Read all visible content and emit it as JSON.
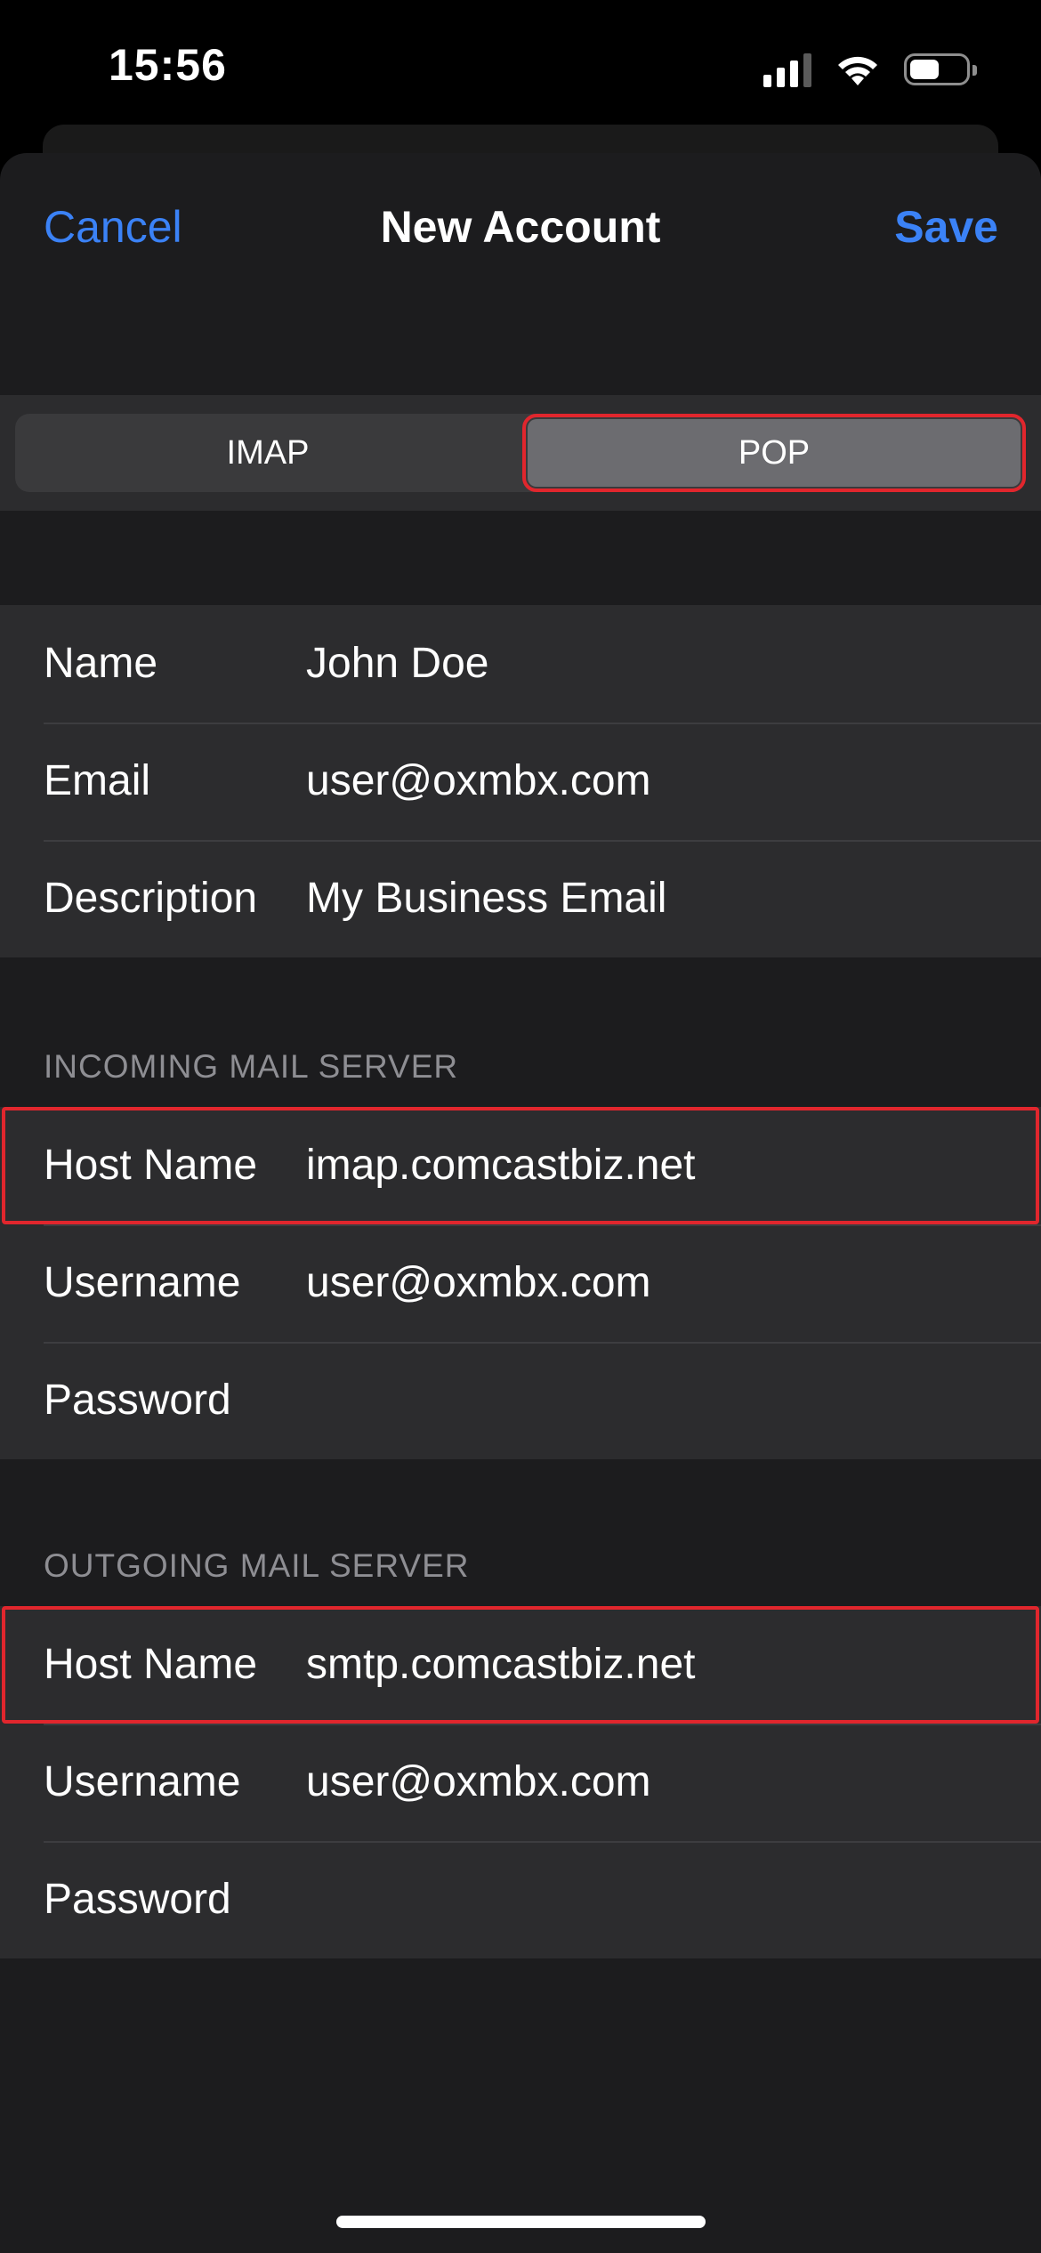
{
  "status_bar": {
    "time": "15:56",
    "icons": [
      "cellular-signal-icon",
      "wifi-icon",
      "battery-icon"
    ]
  },
  "nav": {
    "cancel_label": "Cancel",
    "title": "New Account",
    "save_label": "Save"
  },
  "account_type": {
    "options": [
      "IMAP",
      "POP"
    ],
    "selected": "POP"
  },
  "account": {
    "rows": [
      {
        "label": "Name",
        "value": "John Doe"
      },
      {
        "label": "Email",
        "value": "user@oxmbx.com"
      },
      {
        "label": "Description",
        "value": "My Business Email"
      }
    ]
  },
  "incoming": {
    "header": "INCOMING MAIL SERVER",
    "rows": [
      {
        "label": "Host Name",
        "value": "imap.comcastbiz.net"
      },
      {
        "label": "Username",
        "value": "user@oxmbx.com"
      },
      {
        "label": "Password",
        "value": ""
      }
    ]
  },
  "outgoing": {
    "header": "OUTGOING MAIL SERVER",
    "rows": [
      {
        "label": "Host Name",
        "value": "smtp.comcastbiz.net"
      },
      {
        "label": "Username",
        "value": "user@oxmbx.com"
      },
      {
        "label": "Password",
        "value": ""
      }
    ]
  },
  "colors": {
    "accent": "#3b82f6",
    "highlight": "#e1262d",
    "background": "#1c1c1e",
    "cell": "#2c2c2e"
  }
}
